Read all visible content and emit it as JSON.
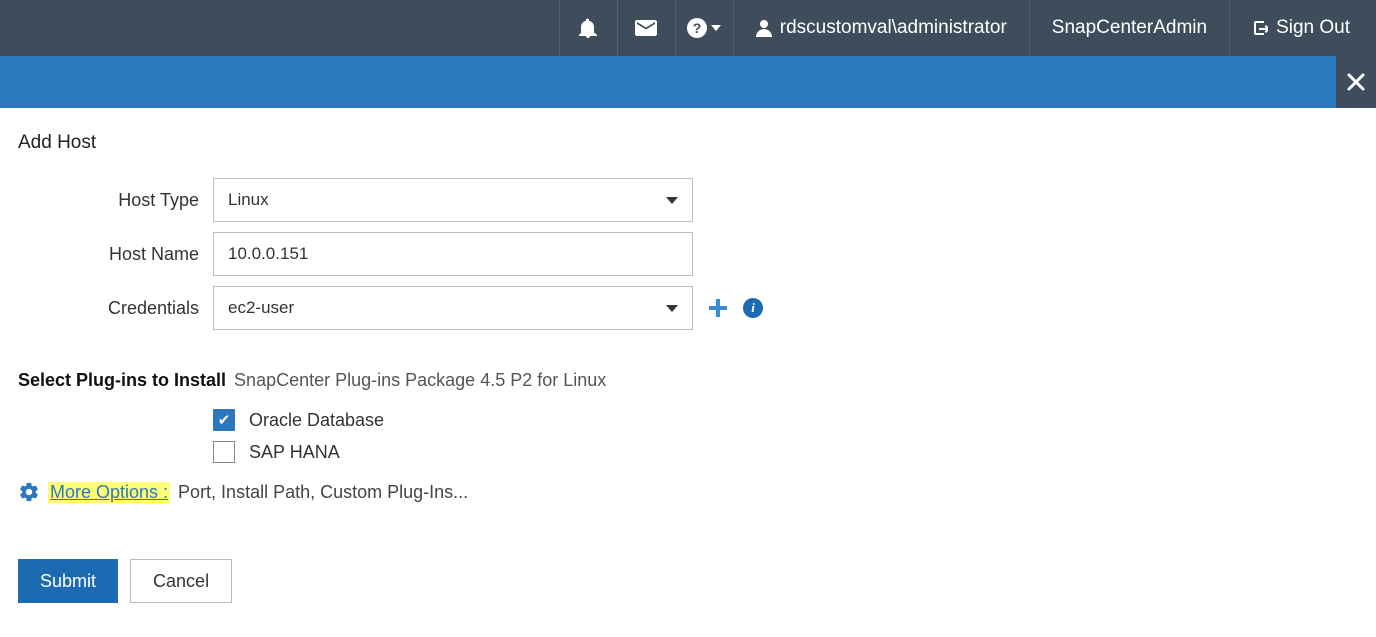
{
  "topnav": {
    "user_label": "rdscustomval\\administrator",
    "role_label": "SnapCenterAdmin",
    "signout_label": "Sign Out"
  },
  "page": {
    "title": "Add Host"
  },
  "form": {
    "host_type_label": "Host Type",
    "host_type_value": "Linux",
    "host_name_label": "Host Name",
    "host_name_value": "10.0.0.151",
    "credentials_label": "Credentials",
    "credentials_value": "ec2-user"
  },
  "plugins": {
    "header_label": "Select Plug-ins to Install",
    "package_label": "SnapCenter Plug-ins Package 4.5 P2 for Linux",
    "items": [
      {
        "label": "Oracle Database",
        "checked": true
      },
      {
        "label": "SAP HANA",
        "checked": false
      }
    ]
  },
  "more_options": {
    "link_label": "More Options :",
    "desc_label": "Port, Install Path, Custom Plug-Ins..."
  },
  "buttons": {
    "submit": "Submit",
    "cancel": "Cancel"
  }
}
